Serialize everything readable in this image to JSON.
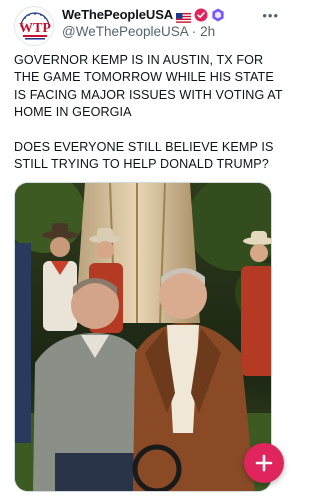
{
  "post": {
    "display_name": "WeThePeopleUSA",
    "handle": "@WeThePeopleUSA",
    "separator": "·",
    "time": "2h",
    "paragraphs": [
      "GOVERNOR KEMP IS IN AUSTIN, TX FOR THE GAME TOMORROW WHILE HIS STATE IS FACING MAJOR ISSUES WITH VOTING AT HOME IN GEORGIA",
      "DOES EVERYONE STILL BELIEVE KEMP IS STILL TRYING TO HELP DONALD TRUMP?"
    ]
  },
  "avatar": {
    "logo_text": "WTP"
  },
  "icons": {
    "flag": "us-flag-icon",
    "verified": "verified-badge-icon",
    "badge": "hexagon-badge-icon",
    "more": "more-options-icon",
    "compose": "compose-plus-icon"
  },
  "colors": {
    "accent": "#e0245e",
    "text": "#0f1419",
    "muted": "#536471",
    "verified": "#e0245e",
    "badge": "#7856ff"
  }
}
